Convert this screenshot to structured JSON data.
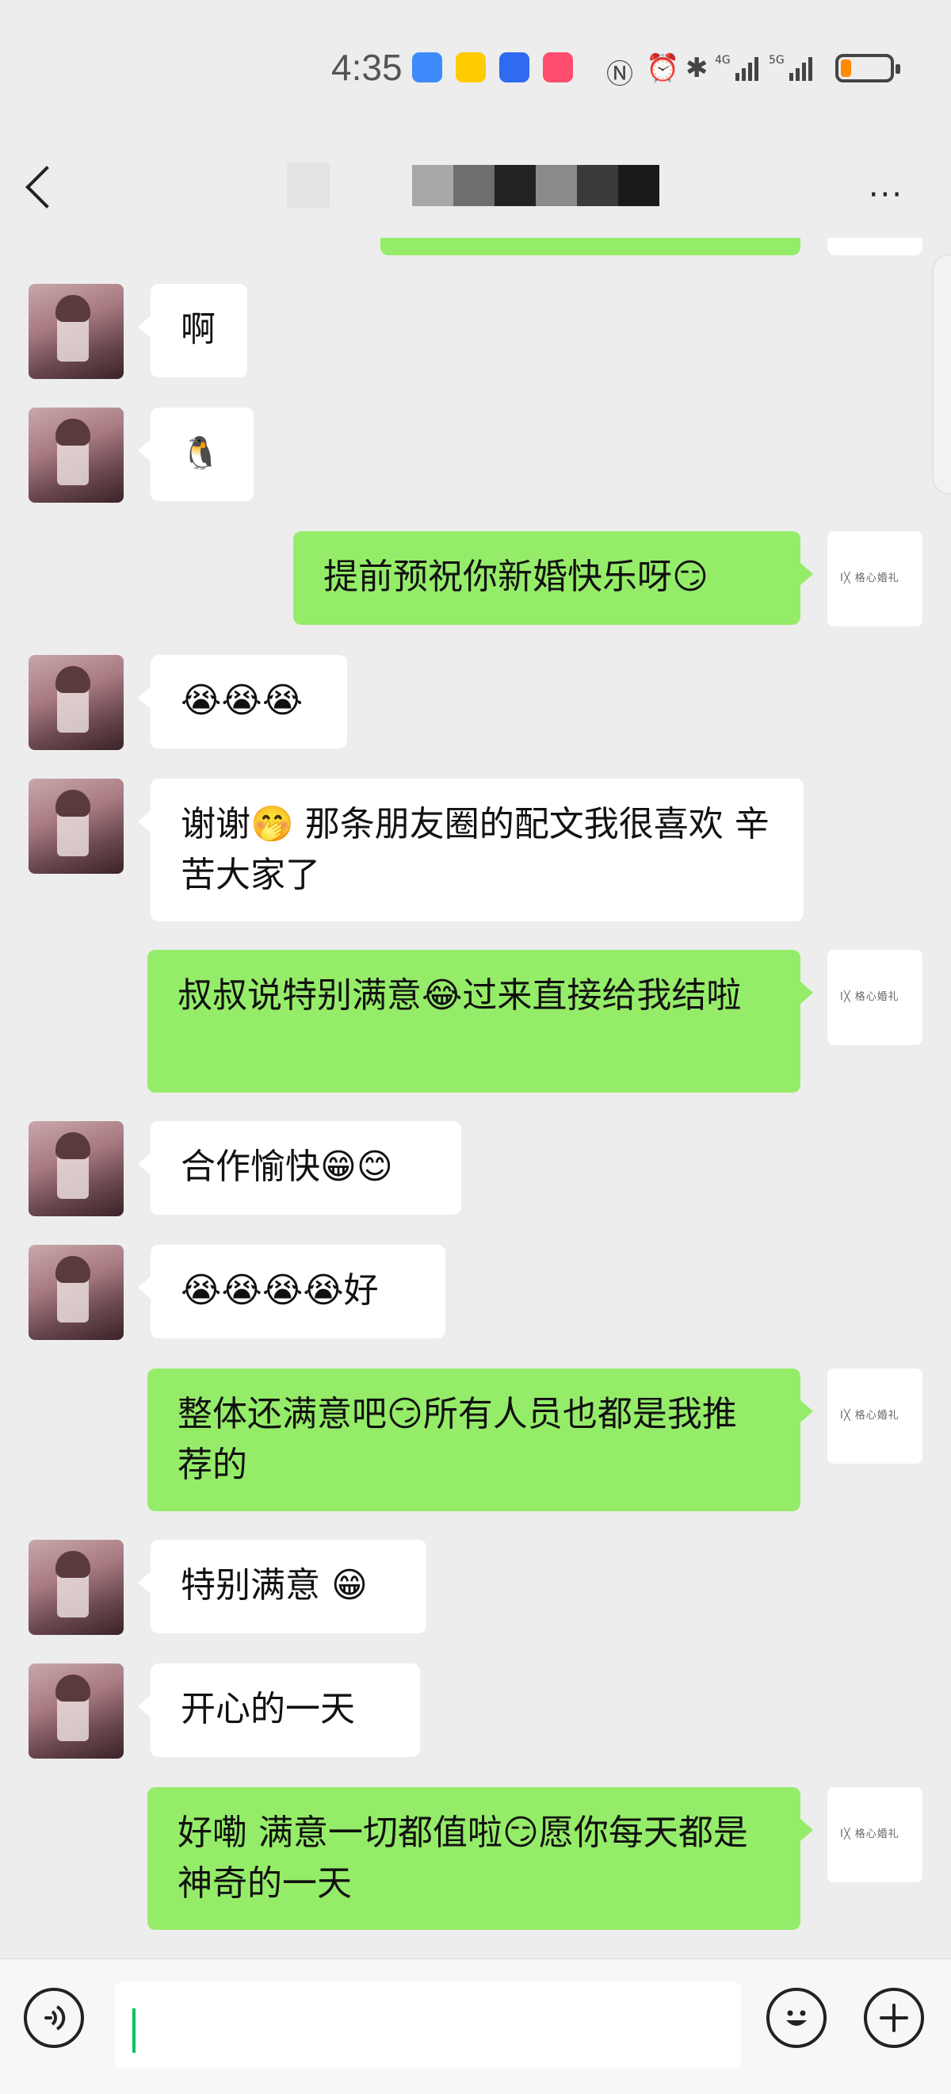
{
  "status_bar": {
    "time": "4:35",
    "network_1": "4G",
    "network_2": "5G",
    "battery_level": 0.2,
    "colors": {
      "battery_fill": "#ff8a00"
    }
  },
  "nav": {
    "back_icon": "chevron-left-icon",
    "more_label": "···"
  },
  "messages": [
    {
      "side": "left",
      "text": "啊"
    },
    {
      "side": "left",
      "text": "🐧"
    },
    {
      "side": "right",
      "text": "提前预祝你新婚快乐呀😏"
    },
    {
      "side": "left",
      "text": "😭😭😭"
    },
    {
      "side": "left",
      "text": "谢谢🤭 那条朋友圈的配文我很喜欢 辛苦大家了"
    },
    {
      "side": "right",
      "text": "叔叔说特别满意😂过来直接给我结啦"
    },
    {
      "side": "left",
      "text": "合作愉快😁😊"
    },
    {
      "side": "left",
      "text": "😭😭😭😭好"
    },
    {
      "side": "right",
      "text": "整体还满意吧😏所有人员也都是我推荐的"
    },
    {
      "side": "left",
      "text": "特别满意 😁"
    },
    {
      "side": "left",
      "text": "开心的一天"
    },
    {
      "side": "right",
      "text": "好嘞  满意一切都值啦😏愿你每天都是神奇的一天"
    }
  ],
  "my_avatar_logo": "I╳ 格心婚礼",
  "input": {
    "voice_icon": "voice-icon",
    "emoji_icon": "emoji-icon",
    "plus_icon": "plus-icon",
    "value": ""
  },
  "colors": {
    "background": "#ededed",
    "my_bubble": "#95ec69",
    "their_bubble": "#ffffff",
    "cursor": "#07c160"
  }
}
